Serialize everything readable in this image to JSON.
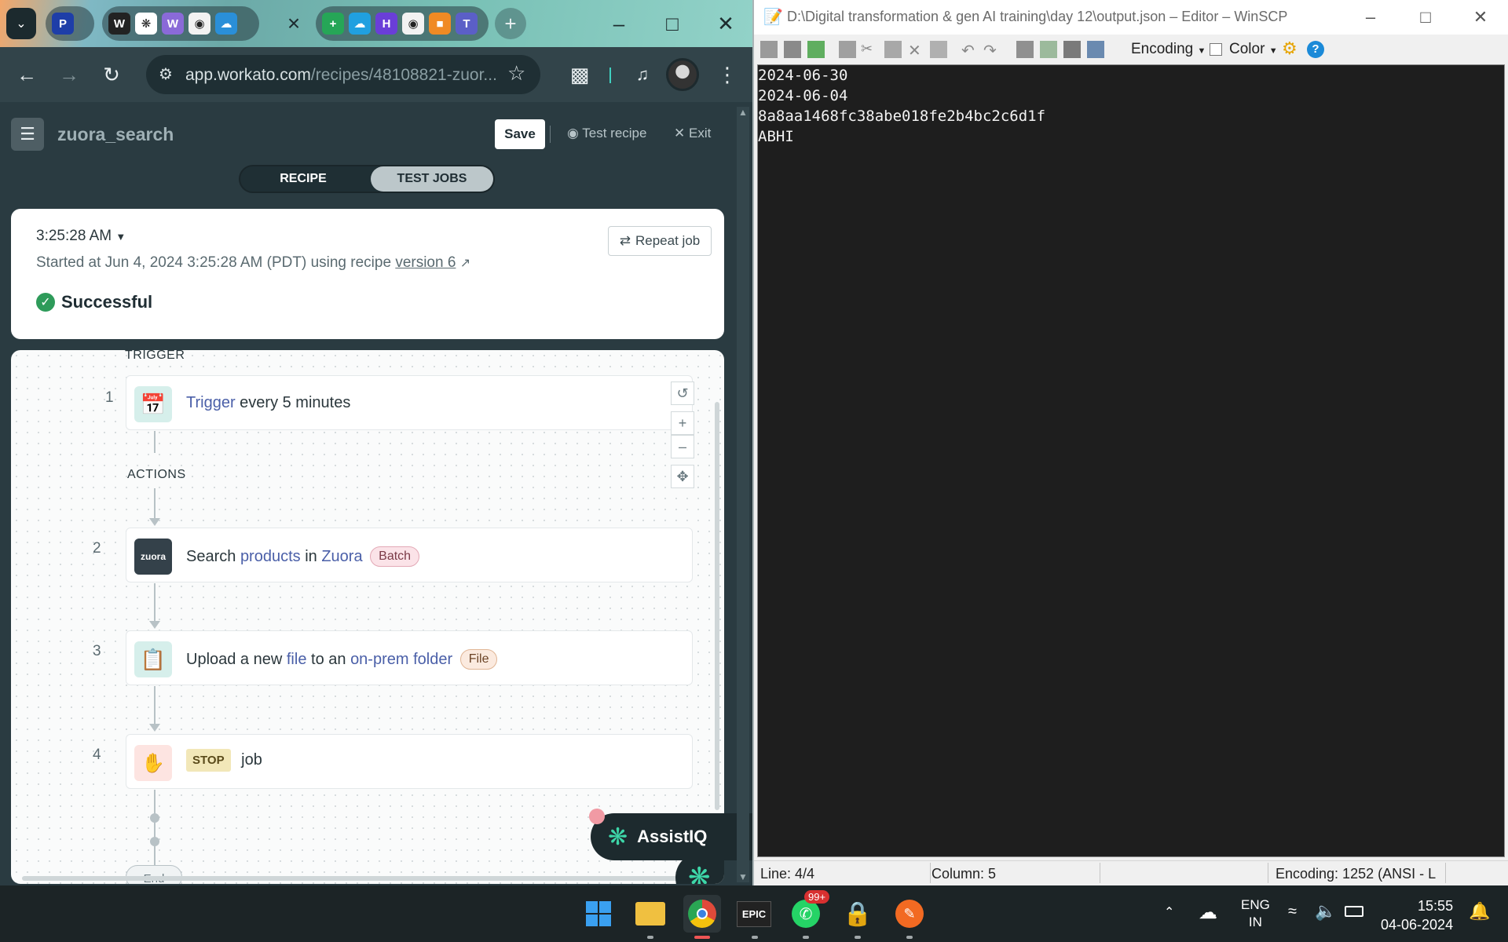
{
  "browser": {
    "url_main": "app.workato.com",
    "url_path": "/recipes/48108821-zuor...",
    "close_tab": "×",
    "new_tab": "+"
  },
  "app": {
    "recipe_name": "zuora_search",
    "save_label": "Save",
    "test_recipe_label": "Test recipe",
    "exit_label": "Exit",
    "tabs": [
      "RECIPE",
      "TEST JOBS"
    ],
    "active_tab": "TEST JOBS"
  },
  "job": {
    "time": "3:25:28 AM",
    "repeat_label": "Repeat job",
    "started_prefix": "Started at Jun 4, 2024 3:25:28 AM (PDT) using recipe ",
    "version_link": "version 6",
    "status": "Successful",
    "status_color": "#2e9b5a"
  },
  "flow": {
    "trigger_label": "TRIGGER",
    "actions_label": "ACTIONS",
    "end_label": "End",
    "steps": [
      {
        "num": "1",
        "parts": [
          "Trigger",
          " every 5 minutes"
        ],
        "icon": "calendar-clock-icon"
      },
      {
        "num": "2",
        "parts": [
          "Search ",
          "products",
          " in ",
          "Zuora"
        ],
        "pill": "Batch",
        "icon": "zuora-logo",
        "icon_text": "zuora"
      },
      {
        "num": "3",
        "parts": [
          "Upload a new ",
          "file",
          " to an ",
          "on-prem folder"
        ],
        "pill": "File",
        "icon": "file-list-icon"
      },
      {
        "num": "4",
        "badge": "STOP",
        "text": "job",
        "icon": "stop-hand-icon"
      }
    ],
    "assist_label": "AssistIQ"
  },
  "winscp": {
    "title": "D:\\Digital transformation & gen AI training\\day 12\\output.json – Editor – WinSCP",
    "encoding_menu": "Encoding",
    "color_menu": "Color",
    "lines": [
      "2024-06-30",
      "2024-06-04",
      "8a8aa1468fc38abe018fe2b4bc2c6d1f",
      "ABHI"
    ],
    "status_line": "Line: 4/4",
    "status_column": "Column: 5",
    "status_encoding": "Encoding: 1252  (ANSI - L"
  },
  "taskbar": {
    "lang": "ENG",
    "region": "IN",
    "time": "15:55",
    "date": "04-06-2024",
    "whatsapp_badge": "99+",
    "epic_label": "EPIC"
  }
}
